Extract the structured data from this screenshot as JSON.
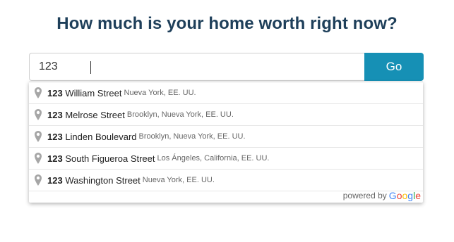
{
  "headline": "How much is your home worth right now?",
  "search": {
    "value": "123",
    "button_label": "Go"
  },
  "suggestions": [
    {
      "match": "123",
      "street": " William Street",
      "secondary": "Nueva York, EE. UU."
    },
    {
      "match": "123",
      "street": " Melrose Street",
      "secondary": "Brooklyn, Nueva York, EE. UU."
    },
    {
      "match": "123",
      "street": " Linden Boulevard",
      "secondary": "Brooklyn, Nueva York, EE. UU."
    },
    {
      "match": "123",
      "street": " South Figueroa Street",
      "secondary": "Los Ángeles, California, EE. UU."
    },
    {
      "match": "123",
      "street": " Washington Street",
      "secondary": "Nueva York, EE. UU."
    }
  ],
  "attribution": {
    "powered_by": "powered by",
    "logo": [
      "G",
      "o",
      "o",
      "g",
      "l",
      "e"
    ]
  },
  "colors": {
    "headline": "#1e3f5a",
    "go_button": "#1690b5"
  },
  "icons": {
    "suggestion_marker": "map-pin-icon"
  }
}
